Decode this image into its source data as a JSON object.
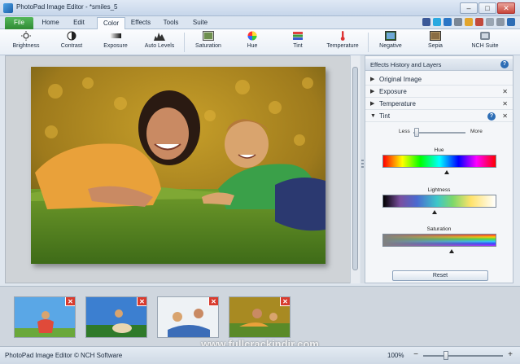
{
  "window": {
    "title": "PhotoPad Image Editor - *smiles_5",
    "buttons": {
      "minimize": "–",
      "maximize": "□",
      "close": "✕"
    }
  },
  "menu": {
    "tabs": [
      {
        "label": "File"
      },
      {
        "label": "Home"
      },
      {
        "label": "Edit"
      },
      {
        "label": "Color"
      },
      {
        "label": "Effects"
      },
      {
        "label": "Tools"
      },
      {
        "label": "Suite"
      }
    ],
    "active": "Color"
  },
  "toolbar": {
    "tools": [
      {
        "label": "Brightness",
        "icon": "brightness-icon"
      },
      {
        "label": "Contrast",
        "icon": "contrast-icon"
      },
      {
        "label": "Exposure",
        "icon": "exposure-icon"
      },
      {
        "label": "Auto Levels",
        "icon": "auto-levels-icon"
      },
      {
        "label": "Saturation",
        "icon": "saturation-icon"
      },
      {
        "label": "Hue",
        "icon": "hue-icon"
      },
      {
        "label": "Tint",
        "icon": "tint-icon"
      },
      {
        "label": "Temperature",
        "icon": "temperature-icon"
      },
      {
        "label": "Negative",
        "icon": "negative-icon"
      },
      {
        "label": "Sepia",
        "icon": "sepia-icon"
      },
      {
        "label": "NCH Suite",
        "icon": "nch-suite-icon"
      }
    ]
  },
  "panel": {
    "title": "Effects History and Layers",
    "effects": [
      {
        "label": "Original Image",
        "expanded": false,
        "removable": false
      },
      {
        "label": "Exposure",
        "expanded": false,
        "removable": true
      },
      {
        "label": "Temperature",
        "expanded": false,
        "removable": true
      },
      {
        "label": "Tint",
        "expanded": true,
        "removable": true
      }
    ],
    "tint": {
      "less_label": "Less",
      "more_label": "More",
      "hue_label": "Hue",
      "lightness_label": "Lightness",
      "saturation_label": "Saturation",
      "reset_label": "Reset"
    }
  },
  "thumbnails": [
    {
      "name": "thumbnail-1"
    },
    {
      "name": "thumbnail-2"
    },
    {
      "name": "thumbnail-3"
    },
    {
      "name": "thumbnail-4"
    }
  ],
  "status": {
    "text": "PhotoPad Image Editor © NCH Software",
    "zoom": "100%"
  },
  "watermark": "www.fullcrackindir.com",
  "colors": {
    "file_tab": "#2f8a34",
    "accent": "#2d6db5",
    "thumb_close": "#d83b2e"
  }
}
